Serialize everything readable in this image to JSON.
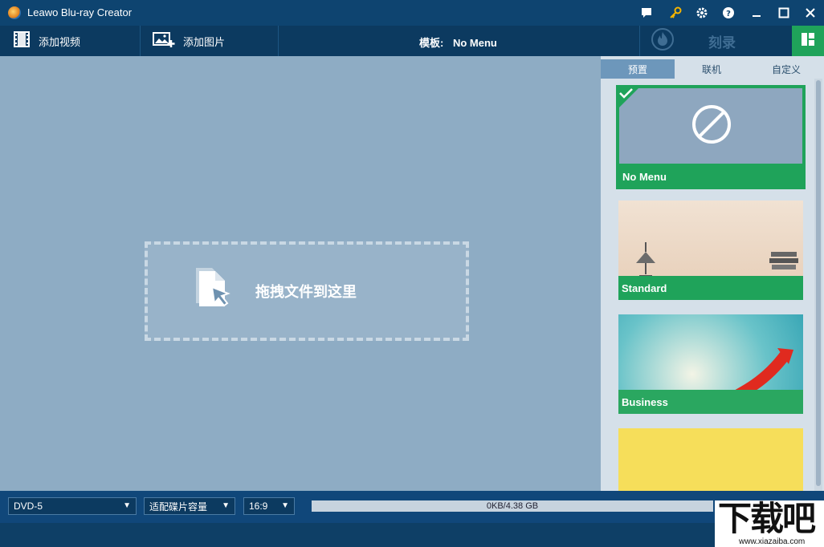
{
  "window": {
    "title": "Leawo Blu-ray Creator"
  },
  "toolbar": {
    "add_video_label": "添加视频",
    "add_photo_label": "添加图片",
    "template_prefix": "模板:",
    "template_value": "No Menu",
    "burn_label": "刻录"
  },
  "drop_zone": {
    "text": "拖拽文件到这里"
  },
  "panel": {
    "tabs": [
      {
        "label": "预置"
      },
      {
        "label": "联机"
      },
      {
        "label": "自定义"
      }
    ],
    "templates": [
      {
        "name": "No Menu",
        "selected": true
      },
      {
        "name": "Standard",
        "selected": false
      },
      {
        "name": "Business",
        "selected": false
      }
    ]
  },
  "status": {
    "disc_type": "DVD-5",
    "fit_mode": "适配碟片容量",
    "aspect_ratio": "16:9",
    "capacity_text": "0KB/4.38 GB",
    "capacity_used_fraction": 0.0
  },
  "watermark": {
    "big": "下载吧",
    "small": "www.xiazaiba.com"
  },
  "colors": {
    "accent_green": "#1fa35a",
    "title_bar": "#0e4470",
    "main_bg": "#8eacc4"
  }
}
